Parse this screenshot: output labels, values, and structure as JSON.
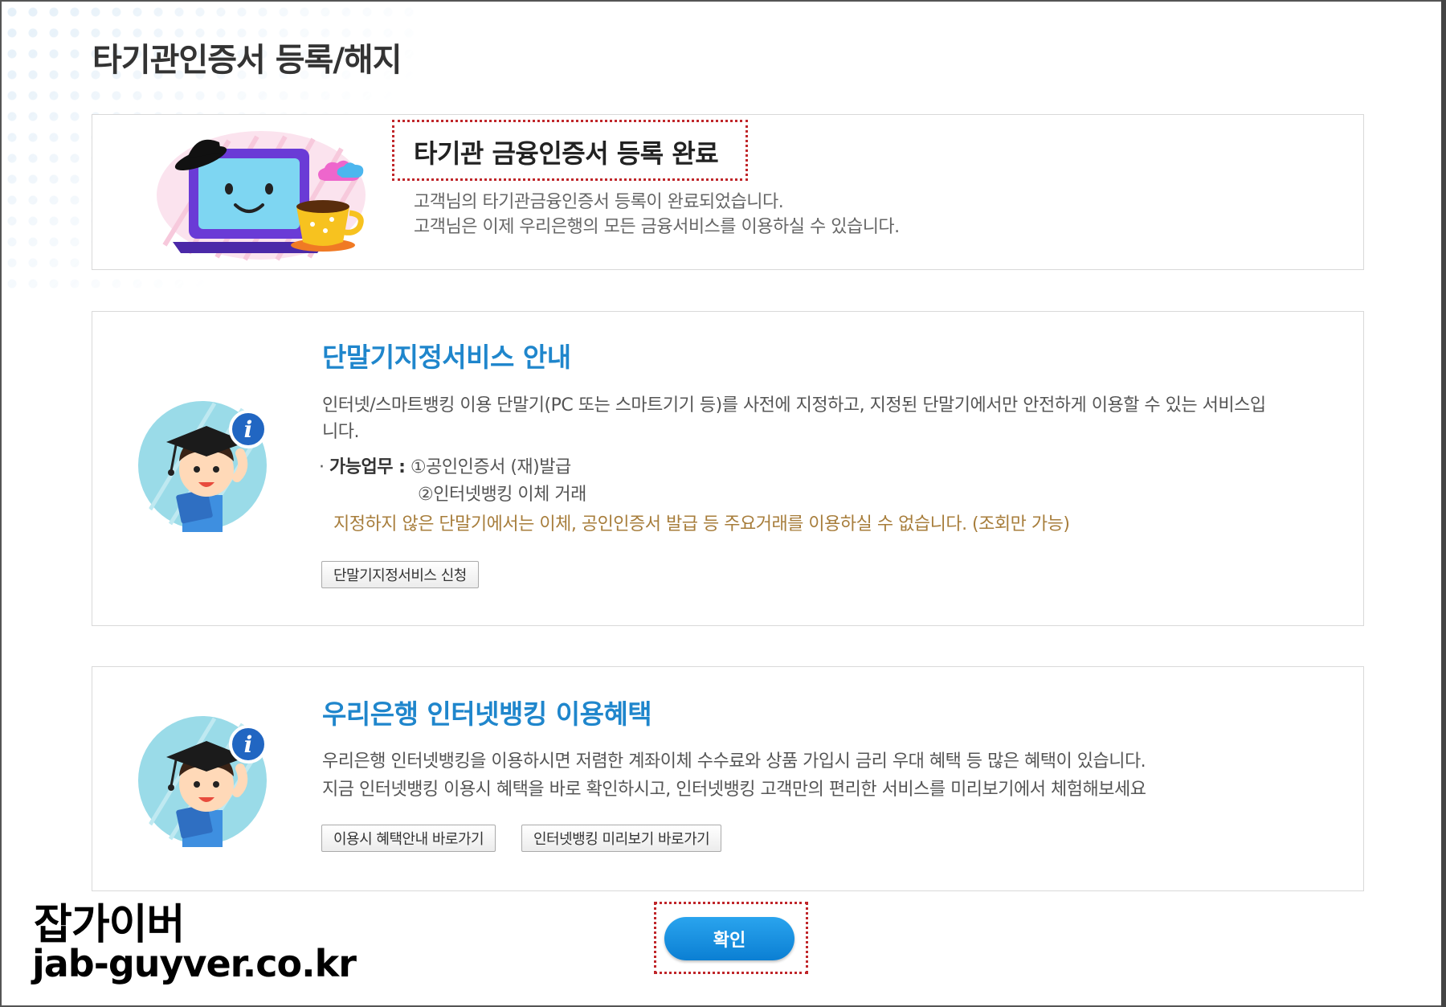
{
  "page": {
    "title": "타기관인증서 등록/해지"
  },
  "completion": {
    "title": "타기관 금융인증서 등록 완료",
    "line1": "고객님의 타기관금융인증서 등록이 완료되었습니다.",
    "line2": "고객님은 이제 우리은행의 모든 금융서비스를 이용하실 수 있습니다."
  },
  "device_service": {
    "title": "단말기지정서비스 안내",
    "desc_line1": "인터넷/스마트뱅킹 이용 단말기(PC 또는 스마트기기 등)를 사전에 지정하고, 지정된 단말기에서만 안전하게 이용할 수 있는 서비스입",
    "desc_line2": "니다.",
    "bullet_label": "가능업무 :",
    "item1": "①공인인증서 (재)발급",
    "item2": "②인터넷뱅킹 이체 거래",
    "warning": "지정하지 않은 단말기에서는 이체, 공인인증서 발급 등 주요거래를 이용하실 수 없습니다. (조회만 가능)",
    "apply_button": "단말기지정서비스 신청"
  },
  "benefits": {
    "title": "우리은행 인터넷뱅킹 이용혜택",
    "line1": "우리은행 인터넷뱅킹을 이용하시면 저렴한 계좌이체 수수료와 상품 가입시 금리 우대 혜택 등 많은 혜택이 있습니다.",
    "line2": "지금 인터넷뱅킹 이용시 혜택을 바로 확인하시고, 인터넷뱅킹 고객만의 편리한 서비스를 미리보기에서 체험해보세요",
    "button1": "이용시 혜택안내 바로가기",
    "button2": "인터넷뱅킹 미리보기 바로가기"
  },
  "confirm_button": "확인",
  "watermark": {
    "korean": "잡가이버",
    "url": "jab-guyver.co.kr"
  },
  "colors": {
    "accent_blue": "#1f86cc",
    "confirm_blue": "#0b7fd3",
    "highlight_red": "#c0262a",
    "warning_brown": "#a77d3b"
  },
  "icons": [
    "laptop-mascot-icon",
    "coffee-cup-icon",
    "cloud-icon",
    "graduate-info-icon"
  ]
}
